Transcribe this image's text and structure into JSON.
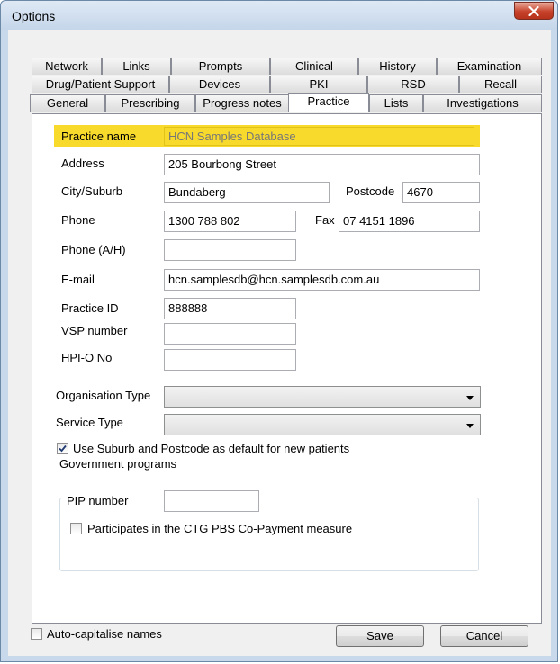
{
  "window": {
    "title": "Options"
  },
  "tabs": {
    "row1": [
      "Network",
      "Links",
      "Prompts",
      "Clinical",
      "History",
      "Examination"
    ],
    "row2": [
      "Drug/Patient Support",
      "Devices",
      "PKI",
      "RSD",
      "Recall"
    ],
    "row3": [
      "General",
      "Prescribing",
      "Progress notes",
      "Practice",
      "Lists",
      "Investigations"
    ],
    "active": "Practice"
  },
  "form": {
    "practice_name": {
      "label": "Practice name",
      "value": "HCN Samples Database"
    },
    "address": {
      "label": "Address",
      "value": "205 Bourbong Street"
    },
    "city": {
      "label": "City/Suburb",
      "value": "Bundaberg"
    },
    "postcode": {
      "label": "Postcode",
      "value": "4670"
    },
    "phone": {
      "label": "Phone",
      "value": "1300 788 802"
    },
    "fax": {
      "label": "Fax",
      "value": "07 4151 1896"
    },
    "phone_ah": {
      "label": "Phone (A/H)",
      "value": ""
    },
    "email": {
      "label": "E-mail",
      "value": "hcn.samplesdb@hcn.samplesdb.com.au"
    },
    "practice_id": {
      "label": "Practice ID",
      "value": "888888"
    },
    "vsp_number": {
      "label": "VSP number",
      "value": ""
    },
    "hpio_no": {
      "label": "HPI-O No",
      "value": ""
    },
    "organisation_type": {
      "label": "Organisation Type",
      "value": ""
    },
    "service_type": {
      "label": "Service Type",
      "value": ""
    },
    "use_suburb_default": {
      "label": "Use Suburb and Postcode as default for new patients",
      "checked": true
    },
    "government_programs": {
      "legend": "Government programs",
      "pip_number": {
        "label": "PIP number",
        "value": ""
      },
      "ctg_pbs": {
        "label": "Participates in the CTG PBS Co-Payment measure",
        "checked": false
      }
    }
  },
  "footer": {
    "auto_capitalise": {
      "label": "Auto-capitalise names",
      "checked": false
    },
    "save_label": "Save",
    "cancel_label": "Cancel"
  },
  "colors": {
    "highlight": "#f8da2c",
    "close_button": "#c6422a",
    "frame": "#c9d9ec"
  }
}
